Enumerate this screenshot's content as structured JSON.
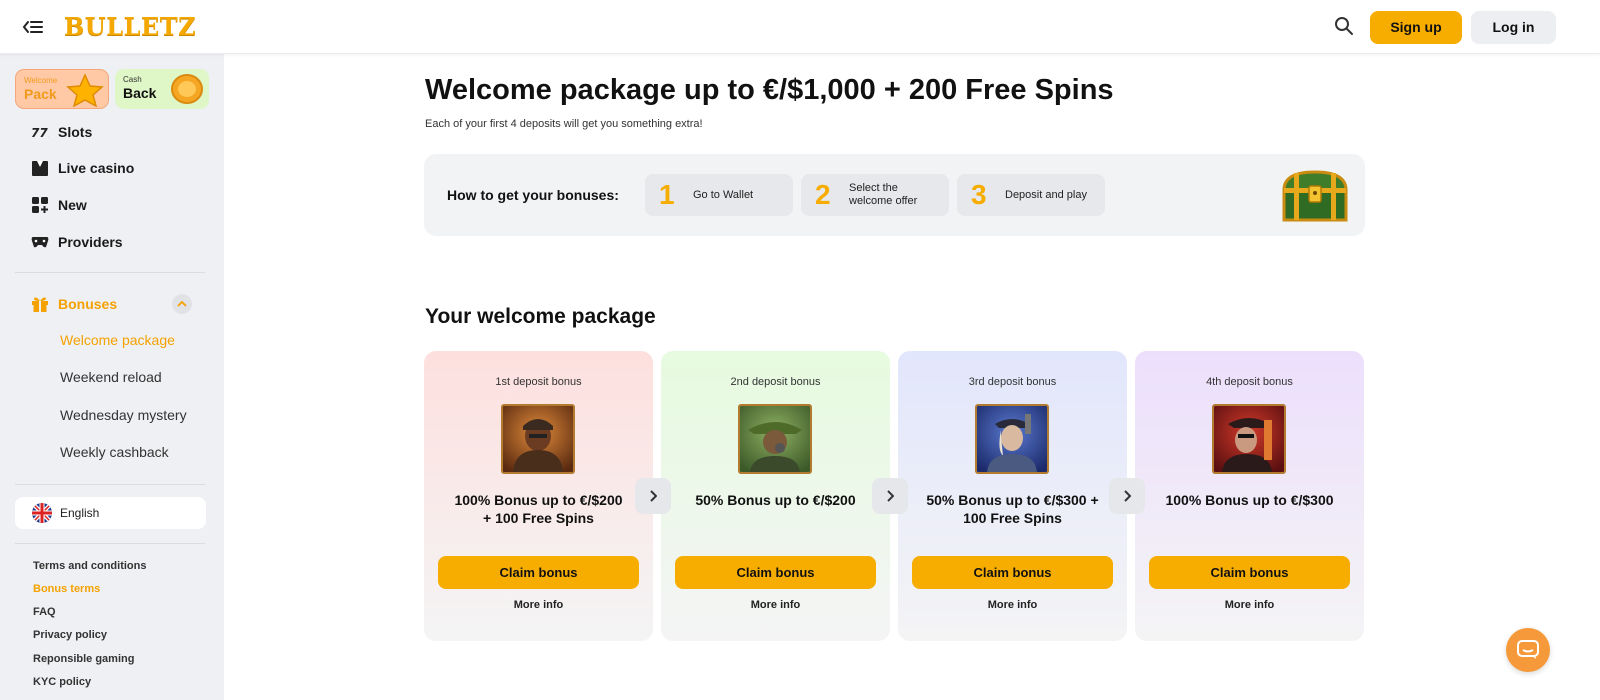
{
  "header": {
    "logo": "BULLETZ",
    "signup_label": "Sign up",
    "login_label": "Log in"
  },
  "sidebar": {
    "promos": [
      {
        "small": "Welcome",
        "big": "Pack"
      },
      {
        "small": "Cash",
        "big": "Back"
      }
    ],
    "nav": [
      {
        "label": "Slots",
        "icon": "slots-icon"
      },
      {
        "label": "Live casino",
        "icon": "live-casino-icon"
      },
      {
        "label": "New",
        "icon": "new-icon"
      },
      {
        "label": "Providers",
        "icon": "providers-icon"
      }
    ],
    "bonuses_label": "Bonuses",
    "bonus_items": [
      "Welcome package",
      "Weekend reload",
      "Wednesday mystery",
      "Weekly cashback"
    ],
    "language": "English",
    "footer_links": [
      "Terms and conditions",
      "Bonus terms",
      "FAQ",
      "Privacy policy",
      "Reponsible gaming",
      "KYC policy"
    ]
  },
  "main": {
    "title": "Welcome package up to €/$1,000 + 200 Free Spins",
    "subtitle": "Each of your first 4 deposits will get you something extra!",
    "howto_label": "How to get your bonuses:",
    "steps": [
      {
        "num": "1",
        "line1": "Go to Wallet",
        "line2": ""
      },
      {
        "num": "2",
        "line1": "Select the",
        "line2": "welcome offer"
      },
      {
        "num": "3",
        "line1": "Deposit and play",
        "line2": ""
      }
    ],
    "package_title": "Your welcome package",
    "cards": [
      {
        "label": "1st deposit bonus",
        "offer_line1": "100% Bonus up to €/$200",
        "offer_line2": "+ 100 Free Spins",
        "claim": "Claim bonus",
        "more": "More info"
      },
      {
        "label": "2nd deposit bonus",
        "offer_line1": "50% Bonus up to €/$200",
        "offer_line2": "",
        "claim": "Claim bonus",
        "more": "More info"
      },
      {
        "label": "3rd deposit bonus",
        "offer_line1": "50% Bonus up to €/$300 +",
        "offer_line2": "100 Free Spins",
        "claim": "Claim bonus",
        "more": "More info"
      },
      {
        "label": "4th deposit bonus",
        "offer_line1": "100% Bonus up to €/$300",
        "offer_line2": "",
        "claim": "Claim bonus",
        "more": "More info"
      }
    ]
  },
  "colors": {
    "accent": "#f7ad00",
    "active_text": "#f5a100",
    "chat": "#f5993a"
  }
}
